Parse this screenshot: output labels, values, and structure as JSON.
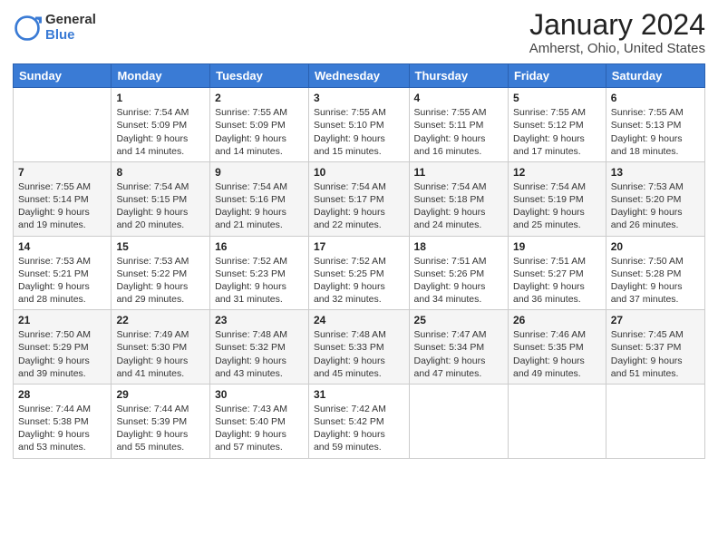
{
  "logo": {
    "general": "General",
    "blue": "Blue"
  },
  "title": "January 2024",
  "subtitle": "Amherst, Ohio, United States",
  "days_of_week": [
    "Sunday",
    "Monday",
    "Tuesday",
    "Wednesday",
    "Thursday",
    "Friday",
    "Saturday"
  ],
  "weeks": [
    [
      {
        "day": "",
        "info": ""
      },
      {
        "day": "1",
        "info": "Sunrise: 7:54 AM\nSunset: 5:09 PM\nDaylight: 9 hours\nand 14 minutes."
      },
      {
        "day": "2",
        "info": "Sunrise: 7:55 AM\nSunset: 5:09 PM\nDaylight: 9 hours\nand 14 minutes."
      },
      {
        "day": "3",
        "info": "Sunrise: 7:55 AM\nSunset: 5:10 PM\nDaylight: 9 hours\nand 15 minutes."
      },
      {
        "day": "4",
        "info": "Sunrise: 7:55 AM\nSunset: 5:11 PM\nDaylight: 9 hours\nand 16 minutes."
      },
      {
        "day": "5",
        "info": "Sunrise: 7:55 AM\nSunset: 5:12 PM\nDaylight: 9 hours\nand 17 minutes."
      },
      {
        "day": "6",
        "info": "Sunrise: 7:55 AM\nSunset: 5:13 PM\nDaylight: 9 hours\nand 18 minutes."
      }
    ],
    [
      {
        "day": "7",
        "info": "Sunrise: 7:55 AM\nSunset: 5:14 PM\nDaylight: 9 hours\nand 19 minutes."
      },
      {
        "day": "8",
        "info": "Sunrise: 7:54 AM\nSunset: 5:15 PM\nDaylight: 9 hours\nand 20 minutes."
      },
      {
        "day": "9",
        "info": "Sunrise: 7:54 AM\nSunset: 5:16 PM\nDaylight: 9 hours\nand 21 minutes."
      },
      {
        "day": "10",
        "info": "Sunrise: 7:54 AM\nSunset: 5:17 PM\nDaylight: 9 hours\nand 22 minutes."
      },
      {
        "day": "11",
        "info": "Sunrise: 7:54 AM\nSunset: 5:18 PM\nDaylight: 9 hours\nand 24 minutes."
      },
      {
        "day": "12",
        "info": "Sunrise: 7:54 AM\nSunset: 5:19 PM\nDaylight: 9 hours\nand 25 minutes."
      },
      {
        "day": "13",
        "info": "Sunrise: 7:53 AM\nSunset: 5:20 PM\nDaylight: 9 hours\nand 26 minutes."
      }
    ],
    [
      {
        "day": "14",
        "info": "Sunrise: 7:53 AM\nSunset: 5:21 PM\nDaylight: 9 hours\nand 28 minutes."
      },
      {
        "day": "15",
        "info": "Sunrise: 7:53 AM\nSunset: 5:22 PM\nDaylight: 9 hours\nand 29 minutes."
      },
      {
        "day": "16",
        "info": "Sunrise: 7:52 AM\nSunset: 5:23 PM\nDaylight: 9 hours\nand 31 minutes."
      },
      {
        "day": "17",
        "info": "Sunrise: 7:52 AM\nSunset: 5:25 PM\nDaylight: 9 hours\nand 32 minutes."
      },
      {
        "day": "18",
        "info": "Sunrise: 7:51 AM\nSunset: 5:26 PM\nDaylight: 9 hours\nand 34 minutes."
      },
      {
        "day": "19",
        "info": "Sunrise: 7:51 AM\nSunset: 5:27 PM\nDaylight: 9 hours\nand 36 minutes."
      },
      {
        "day": "20",
        "info": "Sunrise: 7:50 AM\nSunset: 5:28 PM\nDaylight: 9 hours\nand 37 minutes."
      }
    ],
    [
      {
        "day": "21",
        "info": "Sunrise: 7:50 AM\nSunset: 5:29 PM\nDaylight: 9 hours\nand 39 minutes."
      },
      {
        "day": "22",
        "info": "Sunrise: 7:49 AM\nSunset: 5:30 PM\nDaylight: 9 hours\nand 41 minutes."
      },
      {
        "day": "23",
        "info": "Sunrise: 7:48 AM\nSunset: 5:32 PM\nDaylight: 9 hours\nand 43 minutes."
      },
      {
        "day": "24",
        "info": "Sunrise: 7:48 AM\nSunset: 5:33 PM\nDaylight: 9 hours\nand 45 minutes."
      },
      {
        "day": "25",
        "info": "Sunrise: 7:47 AM\nSunset: 5:34 PM\nDaylight: 9 hours\nand 47 minutes."
      },
      {
        "day": "26",
        "info": "Sunrise: 7:46 AM\nSunset: 5:35 PM\nDaylight: 9 hours\nand 49 minutes."
      },
      {
        "day": "27",
        "info": "Sunrise: 7:45 AM\nSunset: 5:37 PM\nDaylight: 9 hours\nand 51 minutes."
      }
    ],
    [
      {
        "day": "28",
        "info": "Sunrise: 7:44 AM\nSunset: 5:38 PM\nDaylight: 9 hours\nand 53 minutes."
      },
      {
        "day": "29",
        "info": "Sunrise: 7:44 AM\nSunset: 5:39 PM\nDaylight: 9 hours\nand 55 minutes."
      },
      {
        "day": "30",
        "info": "Sunrise: 7:43 AM\nSunset: 5:40 PM\nDaylight: 9 hours\nand 57 minutes."
      },
      {
        "day": "31",
        "info": "Sunrise: 7:42 AM\nSunset: 5:42 PM\nDaylight: 9 hours\nand 59 minutes."
      },
      {
        "day": "",
        "info": ""
      },
      {
        "day": "",
        "info": ""
      },
      {
        "day": "",
        "info": ""
      }
    ]
  ]
}
